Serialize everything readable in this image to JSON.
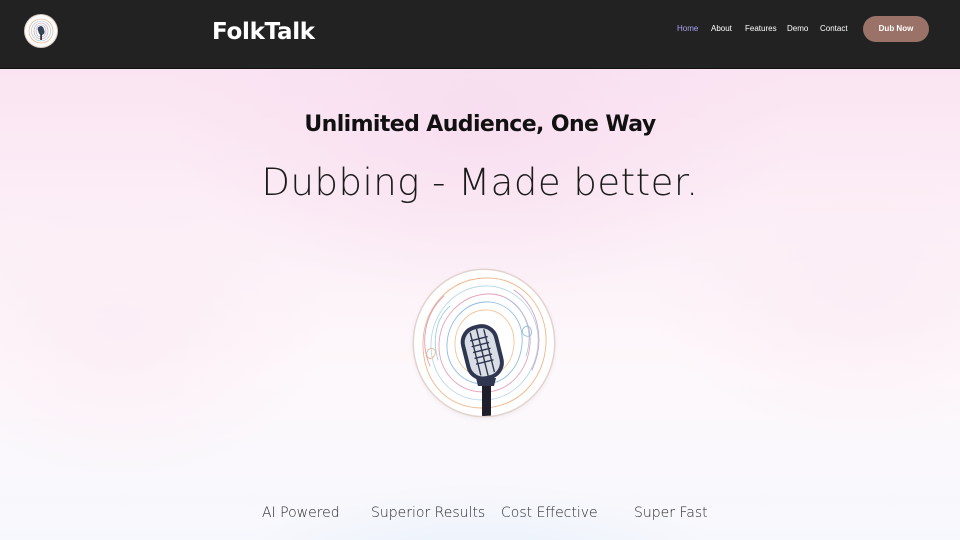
{
  "header": {
    "logo_icon": "microphone-icon",
    "brand": "FolkTalk",
    "nav": [
      {
        "label": "Home",
        "active": true
      },
      {
        "label": "About",
        "active": false
      },
      {
        "label": "Features",
        "active": false
      },
      {
        "label": "Demo",
        "active": false
      },
      {
        "label": "Contact",
        "active": false
      }
    ],
    "cta_label": "Dub Now"
  },
  "hero": {
    "tagline": "Unlimited Audience, One Way",
    "headline": "Dubbing - Made better.",
    "image_icon": "microphone-contour-icon"
  },
  "features": [
    "AI Powered",
    "Superior Results",
    "Cost Effective",
    "Super Fast"
  ],
  "colors": {
    "header_bg": "#222222",
    "accent_active_nav": "#a9a3f0",
    "cta_bg": "#9b7268",
    "hero_bg": "#fae4f2"
  }
}
